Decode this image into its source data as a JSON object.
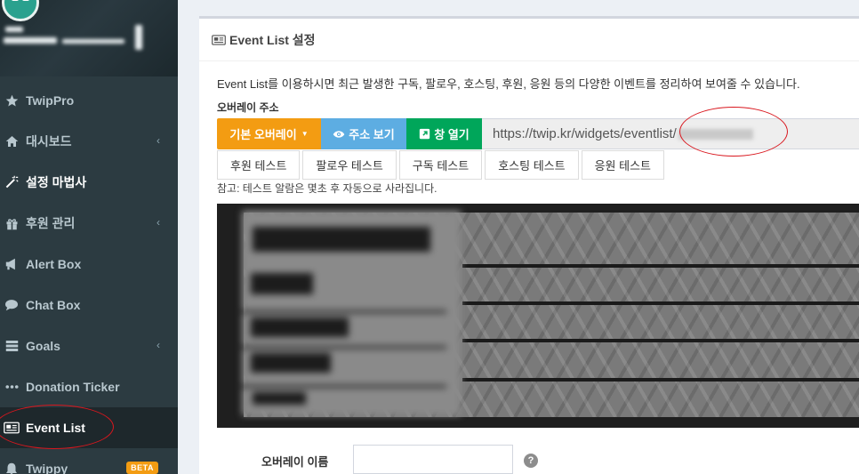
{
  "sidebar": {
    "items": [
      {
        "label": "TwipPro",
        "icon": "star-icon",
        "chevron": ""
      },
      {
        "label": "대시보드",
        "icon": "home-icon",
        "chevron": "‹"
      },
      {
        "label": "설정 마법사",
        "icon": "magic-wand-icon",
        "chevron": ""
      },
      {
        "label": "후원 관리",
        "icon": "gift-icon",
        "chevron": "‹"
      },
      {
        "label": "Alert Box",
        "icon": "bullhorn-icon",
        "chevron": ""
      },
      {
        "label": "Chat Box",
        "icon": "chat-bubble-icon",
        "chevron": ""
      },
      {
        "label": "Goals",
        "icon": "tasks-icon",
        "chevron": "‹"
      },
      {
        "label": "Donation Ticker",
        "icon": "ellipsis-icon",
        "chevron": ""
      },
      {
        "label": "Event List",
        "icon": "newspaper-icon",
        "chevron": ""
      },
      {
        "label": "Twippy",
        "icon": "bell-icon",
        "badge": "BETA"
      }
    ]
  },
  "panel": {
    "title": "Event List 설정",
    "description": "Event List를 이용하시면 최근 발생한 구독, 팔로우, 호스팅, 후원, 응원 등의 다양한 이벤트를 정리하여 보여줄 수 있습니다.",
    "overlay_url_label": "오버레이 주소",
    "buttons": {
      "default_overlay": "기본 오버레이",
      "show_address": "주소 보기",
      "open_window": "창 열기"
    },
    "url_value": "https://twip.kr/widgets/eventlist/",
    "test_buttons": [
      "후원 테스트",
      "팔로우 테스트",
      "구독 테스트",
      "호스팅 테스트",
      "응원 테스트"
    ],
    "note": "참고: 테스트 알람은 몇초 후 자동으로 사라집니다.",
    "overlay_name_label": "오버레이 이름",
    "overlay_name_value": "",
    "help_glyph": "?"
  },
  "colors": {
    "sidebar_bg": "#2c3b41",
    "orange": "#f39c12",
    "blue": "#5dade2",
    "green": "#00a65a",
    "annotation_red": "#d9171e"
  }
}
